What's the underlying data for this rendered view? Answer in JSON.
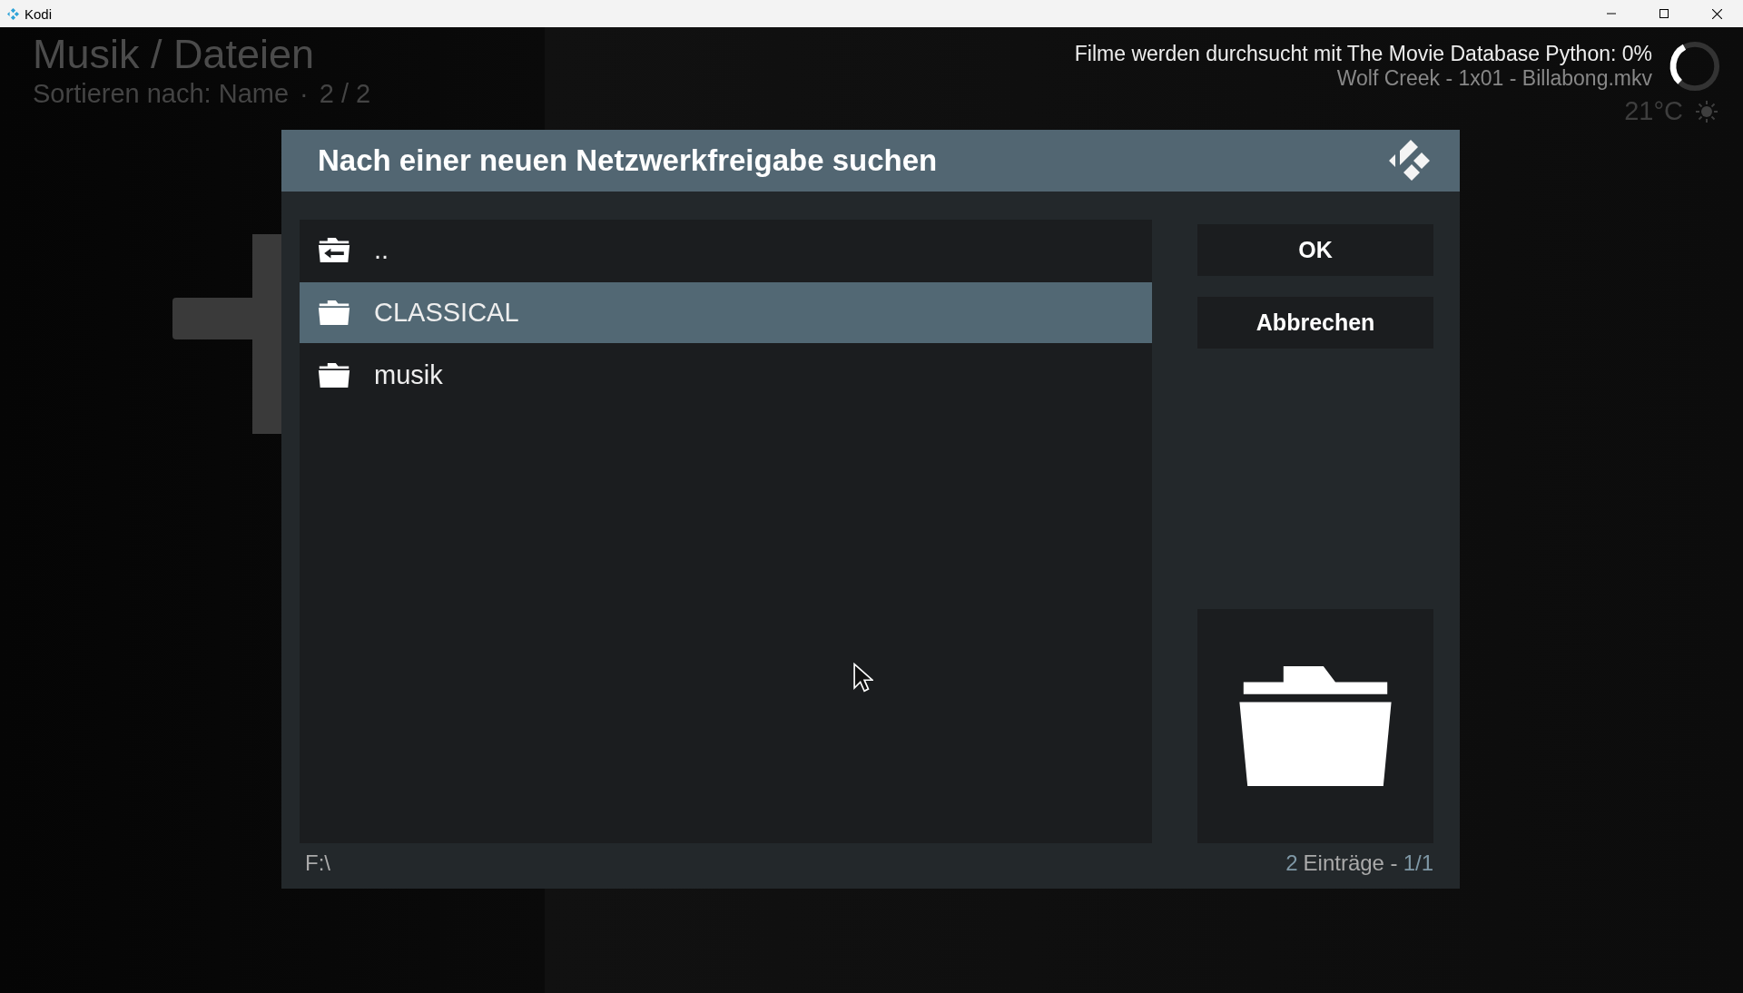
{
  "window": {
    "title": "Kodi"
  },
  "header": {
    "title": "Musik / Dateien",
    "sort": "Sortieren nach: Name",
    "separator": "·",
    "count": "2 / 2"
  },
  "notification": {
    "message": "Filme werden durchsucht mit The Movie Database Python: 0%",
    "file": "Wolf Creek - 1x01 - Billabong.mkv"
  },
  "weather": {
    "temperature": "21°C"
  },
  "dialog": {
    "title": "Nach einer neuen Netzwerkfreigabe suchen",
    "items": [
      {
        "label": "..",
        "kind": "parent",
        "selected": false
      },
      {
        "label": "CLASSICAL",
        "kind": "folder",
        "selected": true
      },
      {
        "label": "musik",
        "kind": "folder",
        "selected": false
      }
    ],
    "buttons": [
      "OK",
      "Abbrechen"
    ],
    "path": "F:\\",
    "count": "2",
    "count_label": "Einträge -",
    "page": "1/1"
  }
}
